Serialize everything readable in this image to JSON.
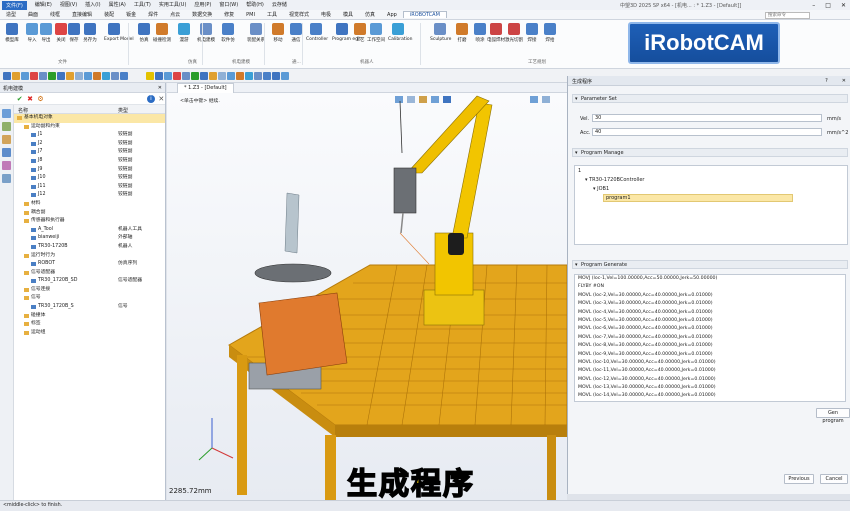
{
  "titlebar": {
    "file_tab": "文件(F)",
    "menus": [
      "文件(F)",
      "编辑(E)",
      "视图(V)",
      "插入(I)",
      "属性(A)",
      "工具(T)",
      "实用工具(U)",
      "应用(P)",
      "窗口(W)",
      "帮助(H)",
      "云存储"
    ],
    "document": "中望3D 2025 SP x64   - [机电... : * 1.Z3 - [Default]]"
  },
  "tabs": [
    "造型",
    "曲面",
    "线框",
    "直接编辑",
    "装配",
    "钣金",
    "焊件",
    "点云",
    "数据交换",
    "修复",
    "PMI",
    "工具",
    "视觉样式",
    "电极",
    "模具",
    "仿真",
    "App",
    "iROBOTCAM"
  ],
  "active_tab": "iROBOTCAM",
  "search_placeholder": "搜索命令",
  "ribbon": {
    "buttons": [
      "模型库",
      "导入",
      "导出",
      "关闭",
      "保存",
      "另存为",
      "Export Model",
      "仿真",
      "碰撞检测",
      "漫游",
      "机电建模",
      "软件仿",
      "装配关系",
      "移动",
      "通信",
      "Controller",
      "Program edit",
      "工艺",
      "工作空间",
      "Calibration",
      "Sculpture",
      "打磨",
      "喷涂",
      "电弧焊材",
      "激光切割",
      "焊接",
      "焊拾"
    ],
    "groups": [
      "文件",
      "仿真",
      "机电建模",
      "通...",
      "机器人",
      "工艺规划"
    ]
  },
  "logo": "iRobotCAM",
  "left_panel": {
    "title": "机电建模",
    "col_name": "名称",
    "col_type": "类型",
    "rows": [
      {
        "name": "基本机电对象",
        "type": "",
        "indent": 0,
        "sel": true
      },
      {
        "name": "运动副和约束",
        "type": "",
        "indent": 1
      },
      {
        "name": "J1",
        "type": "铰链副",
        "indent": 2
      },
      {
        "name": "J2",
        "type": "铰链副",
        "indent": 2
      },
      {
        "name": "J7",
        "type": "铰链副",
        "indent": 2
      },
      {
        "name": "J8",
        "type": "铰链副",
        "indent": 2
      },
      {
        "name": "J9",
        "type": "铰链副",
        "indent": 2
      },
      {
        "name": "J10",
        "type": "铰链副",
        "indent": 2
      },
      {
        "name": "J11",
        "type": "铰链副",
        "indent": 2
      },
      {
        "name": "J12",
        "type": "铰链副",
        "indent": 2
      },
      {
        "name": "材料",
        "type": "",
        "indent": 1
      },
      {
        "name": "耦合副",
        "type": "",
        "indent": 1
      },
      {
        "name": "传感器和执行器",
        "type": "",
        "indent": 1
      },
      {
        "name": "A_Tool",
        "type": "机器人工具",
        "indent": 2
      },
      {
        "name": "bianweiji",
        "type": "外部轴",
        "indent": 2
      },
      {
        "name": "TR30-1720B",
        "type": "机器人",
        "indent": 2
      },
      {
        "name": "运行时行为",
        "type": "",
        "indent": 1
      },
      {
        "name": "ROBOT",
        "type": "仿真序列",
        "indent": 2
      },
      {
        "name": "信号适配器",
        "type": "",
        "indent": 1
      },
      {
        "name": "TR30_1720B_SD",
        "type": "信号适配器",
        "indent": 2
      },
      {
        "name": "信号连接",
        "type": "",
        "indent": 1
      },
      {
        "name": "信号",
        "type": "",
        "indent": 1
      },
      {
        "name": "TR30_1720B_S",
        "type": "信号",
        "indent": 2
      },
      {
        "name": "碰撞体",
        "type": "",
        "indent": 1
      },
      {
        "name": "标签",
        "type": "",
        "indent": 1
      },
      {
        "name": "运动组",
        "type": "",
        "indent": 1
      }
    ]
  },
  "viewport": {
    "tab": "* 1.Z3 - [Default]",
    "message": "<单击中键> 继续.",
    "coord": "2285.72mm",
    "subtitle": "生成程序"
  },
  "dialog": {
    "title": "生成程序",
    "help": "?",
    "sec_params": "Parameter Set",
    "vel_label": "Vel.",
    "vel_value": "30",
    "vel_unit": "mm/s",
    "acc_label": "Acc.",
    "acc_value": "40",
    "acc_unit": "mm/s^2",
    "sec_manage": "Program Manage",
    "tree": [
      "1",
      "TR30-1720BController",
      "JOB1",
      "program1"
    ],
    "sec_generate": "Program Generate",
    "lines": [
      "MOVJ (loc-1,Vel=100.00000,Acc=50.00000,Jerk=50.00000)",
      "FLYBY #ON",
      "MOVL (loc-2,Vel=30.00000,Acc=40.00000,Jerk=0.01000)",
      "MOVL (loc-3,Vel=30.00000,Acc=40.00000,Jerk=0.01000)",
      "MOVL (loc-4,Vel=30.00000,Acc=40.00000,Jerk=0.01000)",
      "MOVL (loc-5,Vel=30.00000,Acc=40.00000,Jerk=0.01000)",
      "MOVL (loc-6,Vel=30.00000,Acc=40.00000,Jerk=0.01000)",
      "MOVL (loc-7,Vel=30.00000,Acc=40.00000,Jerk=0.01000)",
      "MOVL (loc-8,Vel=30.00000,Acc=40.00000,Jerk=0.01000)",
      "MOVL (loc-9,Vel=30.00000,Acc=40.00000,Jerk=0.01000)",
      "MOVL (loc-10,Vel=30.00000,Acc=40.00000,Jerk=0.01000)",
      "MOVL (loc-11,Vel=30.00000,Acc=40.00000,Jerk=0.01000)",
      "MOVL (loc-12,Vel=30.00000,Acc=40.00000,Jerk=0.01000)",
      "MOVL (loc-13,Vel=30.00000,Acc=40.00000,Jerk=0.01000)",
      "MOVL (loc-14,Vel=30.00000,Acc=40.00000,Jerk=0.01000)"
    ],
    "gen_button": "Gen program",
    "previous": "Previous",
    "cancel": "Cancel"
  },
  "status": "<middle-click> to finish.",
  "colors": {
    "accent": "#2b6cc4",
    "robot": "#f2c500",
    "table": "#d9a017",
    "positioner": "#e07a2e",
    "logo": "#1e5fb7"
  }
}
